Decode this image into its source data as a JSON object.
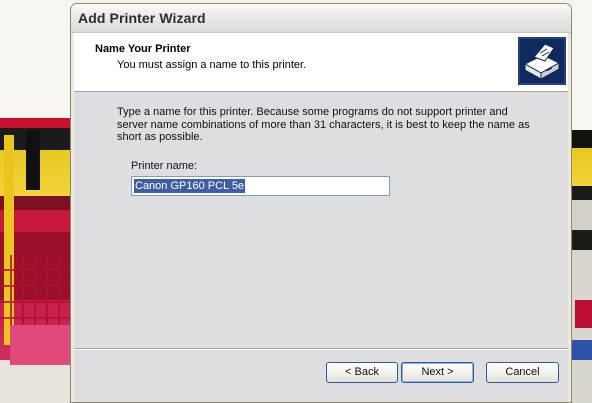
{
  "window": {
    "title": "Add Printer Wizard"
  },
  "header": {
    "title": "Name Your Printer",
    "subtitle": "You must assign a name to this printer.",
    "icon": "printer-icon"
  },
  "body": {
    "description": "Type a name for this printer. Because some programs do not support printer and server name combinations of more than 31 characters, it is best to keep the name as short as possible.",
    "printer_name_label": "Printer name:",
    "printer_name_value": "Canon GP160 PCL 5e"
  },
  "buttons": {
    "back": "< Back",
    "next": "Next >",
    "cancel": "Cancel"
  },
  "colors": {
    "selection": "#3d5ea5",
    "button_border": "#2f5a9b",
    "dialog_face": "#dedde0"
  }
}
